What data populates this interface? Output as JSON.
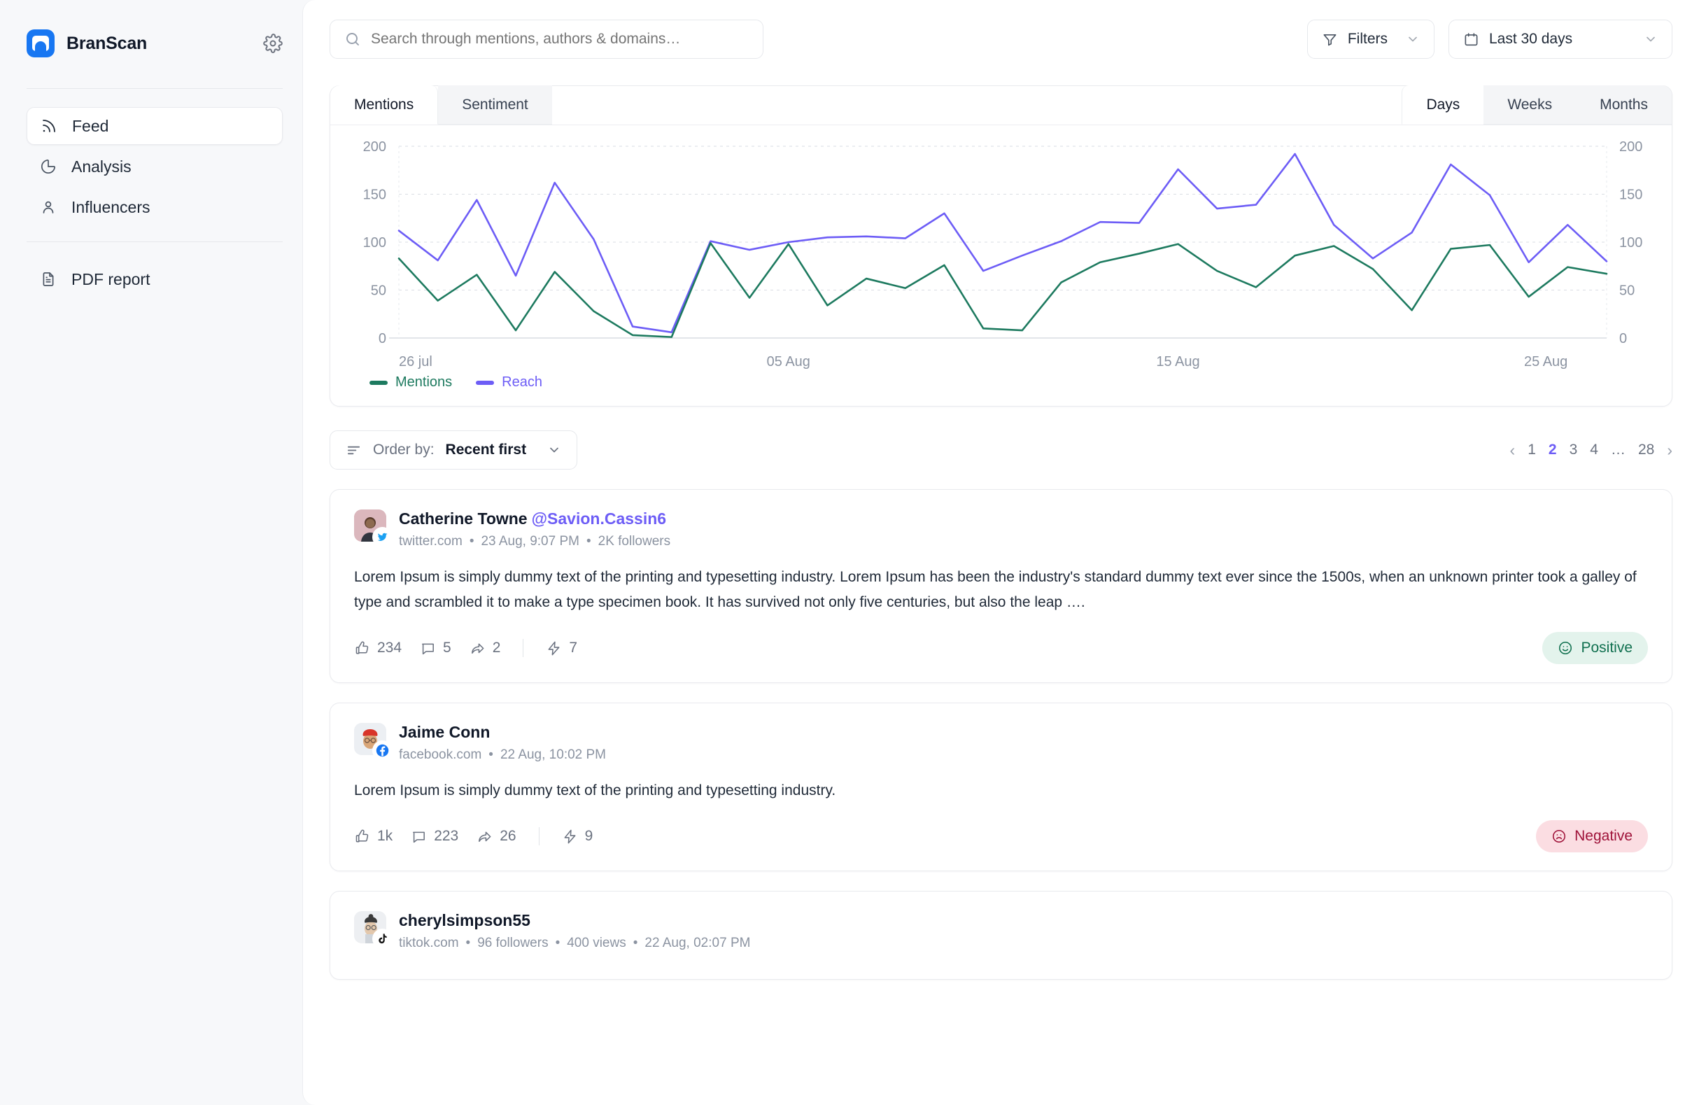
{
  "sidebar": {
    "brand": "BranScan",
    "settings_icon": "gear-icon",
    "items": [
      {
        "label": "Feed",
        "icon": "rss-icon",
        "active": true
      },
      {
        "label": "Analysis",
        "icon": "pie-chart-icon",
        "active": false
      },
      {
        "label": "Influencers",
        "icon": "user-icon",
        "active": false
      },
      {
        "label": "PDF report",
        "icon": "document-icon",
        "active": false
      }
    ]
  },
  "topbar": {
    "search": {
      "placeholder": "Search through mentions, authors & domains…",
      "value": "",
      "icon": "search-icon"
    },
    "filters_label": "Filters",
    "filters_icon": "funnel-icon",
    "date_label": "Last 30 days",
    "date_icon": "calendar-icon"
  },
  "chart_card": {
    "left_tabs": [
      {
        "label": "Mentions",
        "active": true
      },
      {
        "label": "Sentiment",
        "active": false
      }
    ],
    "right_tabs": [
      {
        "label": "Days",
        "active": true
      },
      {
        "label": "Weeks",
        "active": false
      },
      {
        "label": "Months",
        "active": false
      }
    ]
  },
  "chart_data": {
    "type": "line",
    "title": "",
    "xlabel": "",
    "ylabel": "",
    "ylim": [
      0,
      200
    ],
    "yticks": [
      0,
      50,
      100,
      150,
      200
    ],
    "grid": true,
    "dual_axis": true,
    "legend_position": "bottom-left",
    "x_tick_labels": [
      "26 jul",
      "05 Aug",
      "15 Aug",
      "25 Aug"
    ],
    "x_tick_indices": [
      0,
      10,
      20,
      30
    ],
    "x": [
      "26 jul",
      "27 jul",
      "28 jul",
      "29 jul",
      "30 jul",
      "31 jul",
      "01 Aug",
      "02 Aug",
      "03 Aug",
      "04 Aug",
      "05 Aug",
      "06 Aug",
      "07 Aug",
      "08 Aug",
      "09 Aug",
      "10 Aug",
      "11 Aug",
      "12 Aug",
      "13 Aug",
      "14 Aug",
      "15 Aug",
      "16 Aug",
      "17 Aug",
      "18 Aug",
      "19 Aug",
      "20 Aug",
      "21 Aug",
      "22 Aug",
      "23 Aug",
      "24 Aug",
      "25 Aug"
    ],
    "series": [
      {
        "name": "Mentions",
        "color": "#1d7a5f",
        "values": [
          83,
          39,
          66,
          8,
          69,
          28,
          3,
          1,
          99,
          42,
          98,
          34,
          62,
          52,
          76,
          10,
          8,
          58,
          79,
          88,
          98,
          70,
          53,
          86,
          96,
          72,
          29,
          93,
          97,
          43,
          74,
          67
        ]
      },
      {
        "name": "Reach",
        "color": "#6d5df6",
        "values": [
          112,
          81,
          144,
          65,
          162,
          103,
          12,
          6,
          101,
          92,
          100,
          105,
          106,
          104,
          130,
          70,
          86,
          101,
          121,
          120,
          176,
          135,
          139,
          192,
          118,
          83,
          110,
          181,
          149,
          79,
          118,
          80
        ]
      }
    ]
  },
  "legend": [
    {
      "label": "Mentions",
      "color": "#1d7a5f"
    },
    {
      "label": "Reach",
      "color": "#6d5df6"
    }
  ],
  "order_row": {
    "icon": "sort-lines-icon",
    "prefix": "Order by:",
    "value": "Recent first",
    "chevron": "chevron-down-icon"
  },
  "pagination": {
    "prev": "‹",
    "next": "›",
    "pages": [
      "1",
      "2",
      "3",
      "4",
      "…",
      "28"
    ],
    "current": "2"
  },
  "posts": [
    {
      "author": "Catherine Towne",
      "handle": "@Savion.Cassin6",
      "domain": "twitter.com",
      "time": "23 Aug, 9:07 PM",
      "followers": "2K followers",
      "views": "",
      "network": "twitter-icon",
      "avatar_bg": "#dbb7bd",
      "text": "Lorem Ipsum is simply dummy text of the printing and typesetting industry. Lorem Ipsum has been the industry's standard dummy text ever since the 1500s, when an unknown printer took a galley of type and scrambled it to make a type specimen book. It has survived not only five centuries, but also the leap ….",
      "likes": "234",
      "comments": "5",
      "shares": "2",
      "reach": "7",
      "sentiment": "Positive",
      "sentiment_type": "positive",
      "sentiment_icon": "smiley-happy-icon"
    },
    {
      "author": "Jaime Conn",
      "handle": "",
      "domain": "facebook.com",
      "time": "22 Aug, 10:02 PM",
      "followers": "",
      "views": "",
      "network": "facebook-icon",
      "avatar_bg": "#eceff3",
      "text": "Lorem Ipsum is simply dummy text of the printing and typesetting industry.",
      "likes": "1k",
      "comments": "223",
      "shares": "26",
      "reach": "9",
      "sentiment": "Negative",
      "sentiment_type": "negative",
      "sentiment_icon": "smiley-sad-icon"
    },
    {
      "author": "cherylsimpson55",
      "handle": "",
      "domain": "tiktok.com",
      "time": "22 Aug, 02:07 PM",
      "followers": "96 followers",
      "views": "400 views",
      "network": "tiktok-icon",
      "avatar_bg": "#edeff2",
      "text": "",
      "likes": "",
      "comments": "",
      "shares": "",
      "reach": "",
      "sentiment": "",
      "sentiment_type": "",
      "sentiment_icon": ""
    }
  ]
}
